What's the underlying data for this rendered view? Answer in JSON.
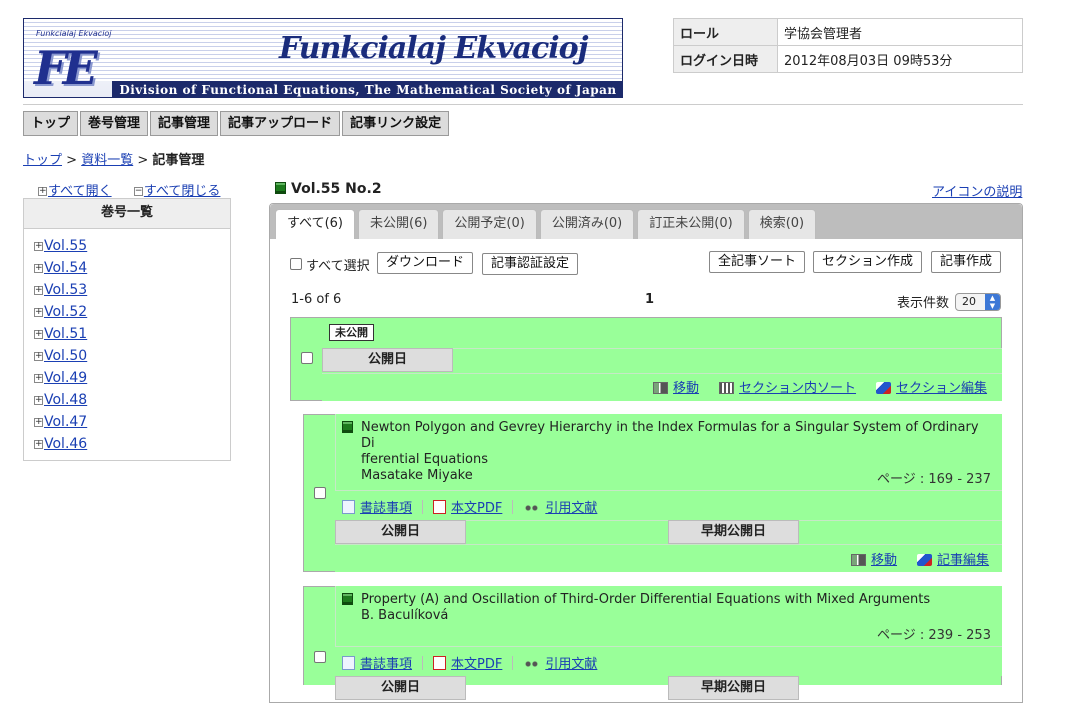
{
  "header": {
    "logo_small": "Funkcialaj Ekvacioj",
    "logo_letters": "FE",
    "title": "Funkcialaj Ekvacioj",
    "subtitle": "Division of Functional Equations, The Mathematical Society of Japan"
  },
  "user_info": {
    "role_label": "ロール",
    "role_value": "学協会管理者",
    "login_label": "ログイン日時",
    "login_value": "2012年08月03日 09時53分"
  },
  "menu": [
    "トップ",
    "巻号管理",
    "記事管理",
    "記事アップロード",
    "記事リンク設定"
  ],
  "breadcrumb": {
    "top": "トップ",
    "sep": " > ",
    "list": "資料一覧",
    "current": "記事管理"
  },
  "sidebar": {
    "expand_all": "すべて開く",
    "collapse_all": "すべて閉じる",
    "heading": "巻号一覧",
    "volumes": [
      "Vol.55",
      "Vol.54",
      "Vol.53",
      "Vol.52",
      "Vol.51",
      "Vol.50",
      "Vol.49",
      "Vol.48",
      "Vol.47",
      "Vol.46"
    ]
  },
  "main": {
    "vol_title": "Vol.55 No.2",
    "icon_help": "アイコンの説明",
    "tabs": [
      "すべて(6)",
      "未公開(6)",
      "公開予定(0)",
      "公開済み(0)",
      "訂正未公開(0)",
      "検索(0)"
    ],
    "select_all": "すべて選択",
    "download": "ダウンロード",
    "auth_setting": "記事認証設定",
    "sort_all": "全記事ソート",
    "create_section": "セクション作成",
    "create_article": "記事作成",
    "count": "1-6 of 6",
    "page": "1",
    "per_page_label": "表示件数",
    "per_page_value": "20"
  },
  "section": {
    "status_badge": "未公開",
    "pub_date_label": "公開日",
    "move": "移動",
    "sort_in_section": "セクション内ソート",
    "edit_section": "セクション編集"
  },
  "articles": [
    {
      "title_line1": "Newton Polygon and Gevrey Hierarchy in the Index Formulas for a Singular System of Ordinary Di",
      "title_line2": "fferential Equations",
      "author": "Masatake Miyake",
      "pages": "ページ : 169 - 237",
      "biblio": "書誌事項",
      "pdf": "本文PDF",
      "refs": "引用文献",
      "pub_date_label": "公開日",
      "early_pub_label": "早期公開日",
      "move": "移動",
      "edit": "記事編集"
    },
    {
      "title_line1": "Property (A) and Oscillation of Third-Order Differential Equations with Mixed Arguments",
      "author": "B. Baculíková",
      "pages": "ページ : 239 - 253",
      "biblio": "書誌事項",
      "pdf": "本文PDF",
      "refs": "引用文献",
      "pub_date_label": "公開日",
      "early_pub_label": "早期公開日"
    }
  ],
  "colors": {
    "row_green": "#99ff99",
    "link": "#1a3fb3",
    "banner_navy": "#1c2a6b"
  }
}
